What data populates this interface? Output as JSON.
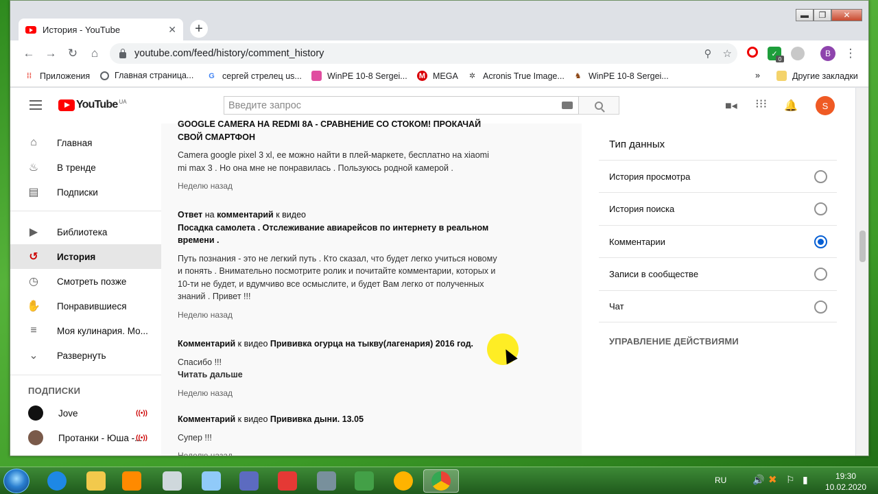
{
  "browser": {
    "tab_title": "История - YouTube",
    "tab_close": "✕",
    "new_tab": "+",
    "url": "youtube.com/feed/history/comment_history",
    "profile_initial": "B",
    "ext_badge": "0",
    "window_controls": {
      "minimize": "▬",
      "maximize": "❐",
      "close": "✕"
    }
  },
  "bookmarks": {
    "items": [
      {
        "label": "Приложения",
        "icon": "apps-grid-icon",
        "color": "#ea4335"
      },
      {
        "label": "Главная страница...",
        "icon": "globe-icon",
        "color": "#5f6368"
      },
      {
        "label": "сергей стрелец us...",
        "icon": "google-icon",
        "color": "#4285f4"
      },
      {
        "label": "WinPE 10-8 Sergei...",
        "icon": "winpe-icon",
        "color": "#d81b60"
      },
      {
        "label": "MEGA",
        "icon": "mega-icon",
        "color": "#d90007"
      },
      {
        "label": "Acronis True Image...",
        "icon": "acronis-icon",
        "color": "#444"
      },
      {
        "label": "WinPE 10-8 Sergei...",
        "icon": "winpe2-icon",
        "color": "#8b4513"
      }
    ],
    "overflow": "»",
    "other": "Другие закладки"
  },
  "youtube": {
    "logo_text": "YouTube",
    "region": "UA",
    "search_placeholder": "Введите запрос",
    "avatar_initial": "S"
  },
  "sidebar": {
    "items": [
      {
        "label": "Главная",
        "icon": "home-icon",
        "glyph": "⌂"
      },
      {
        "label": "В тренде",
        "icon": "fire-icon",
        "glyph": "♨"
      },
      {
        "label": "Подписки",
        "icon": "subscriptions-icon",
        "glyph": "▤"
      },
      {
        "label": "Библиотека",
        "icon": "library-icon",
        "glyph": "▶"
      },
      {
        "label": "История",
        "icon": "history-icon",
        "glyph": "↺"
      },
      {
        "label": "Смотреть позже",
        "icon": "clock-icon",
        "glyph": "◷"
      },
      {
        "label": "Понравившиеся",
        "icon": "thumb-up-icon",
        "glyph": "👍"
      },
      {
        "label": "Моя кулинария. Мо...",
        "icon": "playlist-icon",
        "glyph": "≡"
      },
      {
        "label": "Развернуть",
        "icon": "chevron-down-icon",
        "glyph": "⌄"
      }
    ],
    "subs_title": "ПОДПИСКИ",
    "subscriptions": [
      {
        "label": "Jove",
        "live": "((•))"
      },
      {
        "label": "Протанки - Юша -...",
        "live": "((•))"
      }
    ]
  },
  "feed": {
    "entries": [
      {
        "title_partial": "GOOGLE CAMERA НА REDMI 8A - СРАВНЕНИЕ СО СТОКОМ! ПРОКАЧАЙ СВОЙ СМАРТФОН",
        "body": "Camera google pixel 3 xl, ее можно найти в плей-маркете, бесплатно на xiaomi mi  max 3 . Но она мне не понравилась . Пользуюсь родной камерой .",
        "ago": "Неделю назад"
      },
      {
        "head_a": "Ответ",
        "head_b": " на ",
        "head_c": "комментарий",
        "head_d": " к видео",
        "video": "Посадка самолета . Отслеживание авиарейсов по интернету в реальном времени .",
        "body": "Путь познания - это не легкий путь . Кто сказал, что будет легко учиться новому и понять . Внимательно посмотрите ролик и почитайте комментарии, которых и 10-ти не будет, и вдумчиво все осмыслите, и будет Вам легко от полученных знаний . Привет !!!",
        "ago": "Неделю назад"
      },
      {
        "head_a": "Комментарий",
        "head_b": " к видео ",
        "video": "Прививка огурца на тыкву(лагенария) 2016 год.",
        "body": "Спасибо !!!",
        "more": "Читать дальше",
        "ago": "Неделю назад"
      },
      {
        "head_a": "Комментарий",
        "head_b": " к видео ",
        "video": "Прививка дыни. 13.05",
        "body": "Супер !!!",
        "ago": "Неделю назад"
      }
    ]
  },
  "rpanel": {
    "title": "Тип данных",
    "options": [
      {
        "label": "История просмотра",
        "selected": false
      },
      {
        "label": "История поиска",
        "selected": false
      },
      {
        "label": "Комментарии",
        "selected": true
      },
      {
        "label": "Записи в сообществе",
        "selected": false
      },
      {
        "label": "Чат",
        "selected": false
      }
    ],
    "manage": "УПРАВЛЕНИЕ ДЕЙСТВИЯМИ"
  },
  "taskbar": {
    "lang": "RU",
    "time": "19:30",
    "date": "10.02.2020",
    "apps": [
      {
        "icon": "ie-icon",
        "color": "#1e88e5"
      },
      {
        "icon": "explorer-icon",
        "color": "#f2c94c"
      },
      {
        "icon": "media-player-icon",
        "color": "#ff8a00"
      },
      {
        "icon": "calculator-icon",
        "color": "#cfd8dc"
      },
      {
        "icon": "notepad-icon",
        "color": "#90caf9"
      },
      {
        "icon": "network-icon",
        "color": "#5c6bc0"
      },
      {
        "icon": "dice-icon",
        "color": "#e53935"
      },
      {
        "icon": "computer-icon",
        "color": "#78909c"
      },
      {
        "icon": "solitaire-icon",
        "color": "#43a047"
      },
      {
        "icon": "burning-icon",
        "color": "#ffb300"
      },
      {
        "icon": "chrome-icon",
        "color": "#4285f4"
      }
    ]
  }
}
